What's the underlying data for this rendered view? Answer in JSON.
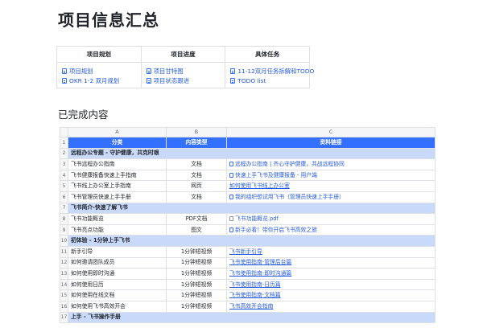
{
  "page_title": "项目信息汇总",
  "summary": {
    "headers": [
      "项目规划",
      "项目进度",
      "具体任务"
    ],
    "cols": [
      [
        "项目规划",
        "OKR 1-2 双月规划"
      ],
      [
        "项目甘特图",
        "项目状态跟进"
      ],
      [
        "11-12双月任务拆解和TODO",
        "TODO list"
      ]
    ]
  },
  "section_title": "已完成内容",
  "sheet": {
    "col_letters": [
      "A",
      "B",
      "C"
    ],
    "header": [
      "分类",
      "内容类型",
      "资料链接"
    ],
    "rows": [
      {
        "n": "2",
        "group": "远程办公专题 - 守护健康，共克时艰"
      },
      {
        "n": "3",
        "a": "飞书远程办公指南",
        "b": "文档",
        "c": "远程办公指南 | 齐心守护健康，共战远程协同",
        "icon": "doc"
      },
      {
        "n": "4",
        "a": "飞书健康报备快速上手指南",
        "b": "文档",
        "c": "快速上手飞书及健康报备 - 用户端",
        "icon": "doc"
      },
      {
        "n": "5",
        "a": "飞书线上办公室上手指南",
        "b": "网页",
        "c": "如何使用飞书线上办公室",
        "icon": "link"
      },
      {
        "n": "6",
        "a": "飞书管理员快速上手手册",
        "b": "文档",
        "c": "我的组织想试用飞书（管理员快速上手手册）",
        "icon": "doc"
      },
      {
        "n": "7",
        "group": "飞书简介-快速了解飞书"
      },
      {
        "n": "8",
        "a": "飞书功能概览",
        "b": "PDF文档",
        "c": "飞书功能概览.pdf",
        "icon": "file"
      },
      {
        "n": "9",
        "a": "飞书亮点功能",
        "b": "图文",
        "c": "新手必看！带你开启飞书高效之旅",
        "icon": "doc"
      },
      {
        "n": "10",
        "group": "初体验 - 1分钟上手飞书"
      },
      {
        "n": "11",
        "a": "新手引导",
        "b": "1分钟短视频",
        "c": "飞书新手引导",
        "icon": "link"
      },
      {
        "n": "12",
        "a": "如何邀请团队成员",
        "b": "1分钟短视频",
        "c": "飞书使用指南-管理后台篇",
        "icon": "link"
      },
      {
        "n": "13",
        "a": "如何使用即时沟通",
        "b": "1分钟短视频",
        "c": "飞书使用指南-即时沟通篇",
        "icon": "link"
      },
      {
        "n": "14",
        "a": "如何使用日历",
        "b": "1分钟短视频",
        "c": "飞书使用指南-日历篇",
        "icon": "link"
      },
      {
        "n": "15",
        "a": "如何使用在线文档",
        "b": "1分钟短视频",
        "c": "飞书使用指南-文档篇",
        "icon": "link"
      },
      {
        "n": "16",
        "a": "如何使用飞书高效开会",
        "b": "1分钟短视频",
        "c": "飞书高效开会指南",
        "icon": "link"
      },
      {
        "n": "17",
        "group": "上手 - 飞书操作手册"
      }
    ]
  }
}
